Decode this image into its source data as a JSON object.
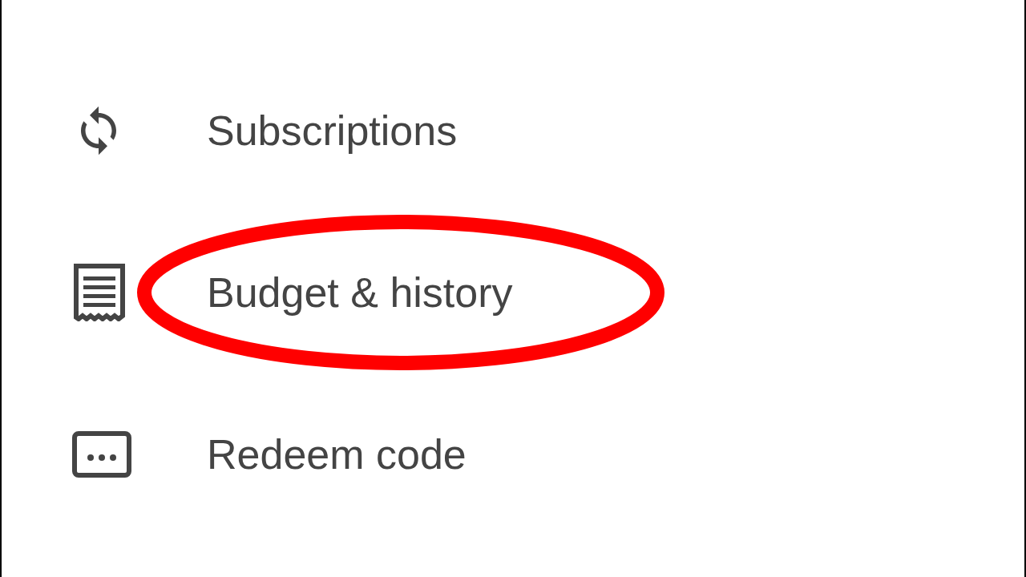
{
  "menu": {
    "items": [
      {
        "kind": "sync",
        "label": "Subscriptions",
        "circled": false
      },
      {
        "kind": "receipt",
        "label": "Budget & history",
        "circled": true
      },
      {
        "kind": "dots",
        "label": "Redeem code",
        "circled": false
      }
    ]
  }
}
